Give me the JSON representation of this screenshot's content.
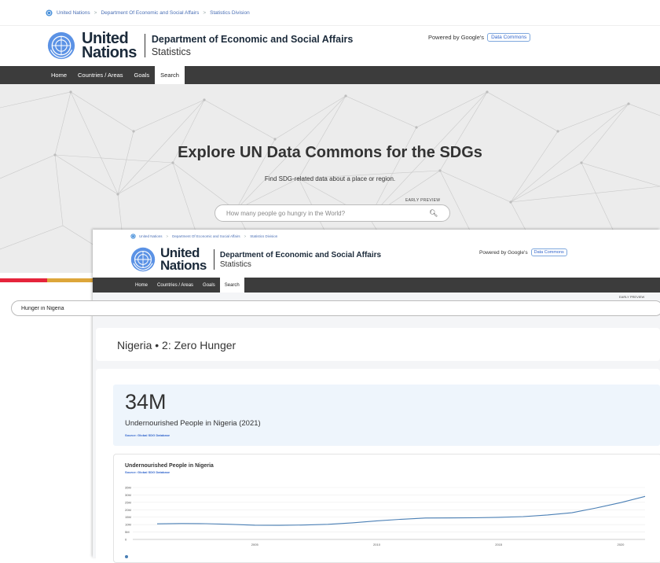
{
  "back_page": {
    "breadcrumb": [
      "United Nations",
      "Department Of Economic and Social Affairs",
      "Statistics Division"
    ],
    "logo": {
      "line1": "United",
      "line2": "Nations"
    },
    "dept": {
      "title": "Department of Economic and Social Affairs",
      "subtitle": "Statistics"
    },
    "powered": {
      "text": "Powered by Google's",
      "chip": "Data Commons"
    },
    "nav": [
      "Home",
      "Countries / Areas",
      "Goals",
      "Search"
    ],
    "active_nav": "Search",
    "hero": {
      "title": "Explore UN Data Commons for the SDGs",
      "subtitle": "Find SDG-related data about a place or region.",
      "badge": "EARLY PREVIEW",
      "search_placeholder": "How many people go hungry in the World?"
    },
    "stripe_colors": [
      "#e5243b",
      "#dda63a",
      "#4c9f38"
    ]
  },
  "front_page": {
    "breadcrumb": [
      "United Nations",
      "Department Of Economic and Social Affairs",
      "Statistics Division"
    ],
    "logo": {
      "line1": "United",
      "line2": "Nations"
    },
    "dept": {
      "title": "Department of Economic and Social Affairs",
      "subtitle": "Statistics"
    },
    "powered": {
      "text": "Powered by Google's",
      "chip": "Data Commons"
    },
    "nav": [
      "Home",
      "Countries / Areas",
      "Goals",
      "Search"
    ],
    "active_nav": "Search",
    "badge": "EARLY PREVIEW",
    "search_value": "Hunger in Nigeria",
    "place_title": "Nigeria • 2: Zero Hunger",
    "highlight": {
      "value": "34M",
      "description": "Undernourished People in Nigeria (2021)",
      "source_label": "Source:",
      "source_link": "Global SDG Database"
    },
    "chart_card": {
      "title": "Undernourished People in Nigeria",
      "source_label": "Source:",
      "source_link": "Global SDG Database"
    }
  },
  "chart_data": {
    "type": "line",
    "title": "Undernourished People in Nigeria",
    "xlabel": "",
    "ylabel": "",
    "y_ticks": [
      "0",
      "5M",
      "10M",
      "15M",
      "20M",
      "25M",
      "30M",
      "35M"
    ],
    "x_ticks": [
      "2005",
      "2010",
      "2015",
      "2020"
    ],
    "ylim": [
      0,
      35000000
    ],
    "xlim": [
      2000,
      2021
    ],
    "series": [
      {
        "name": "",
        "color": "#4a7fb5",
        "x": [
          2001,
          2002,
          2003,
          2004,
          2005,
          2006,
          2007,
          2008,
          2009,
          2010,
          2011,
          2012,
          2013,
          2014,
          2015,
          2016,
          2017,
          2018,
          2019,
          2020,
          2021
        ],
        "y": [
          10500000,
          10700000,
          10600000,
          10200000,
          9600000,
          9500000,
          9700000,
          10200000,
          11200000,
          12500000,
          13600000,
          14400000,
          14500000,
          14600000,
          14900000,
          15400000,
          16500000,
          18000000,
          21200000,
          24800000,
          29000000
        ]
      }
    ]
  }
}
